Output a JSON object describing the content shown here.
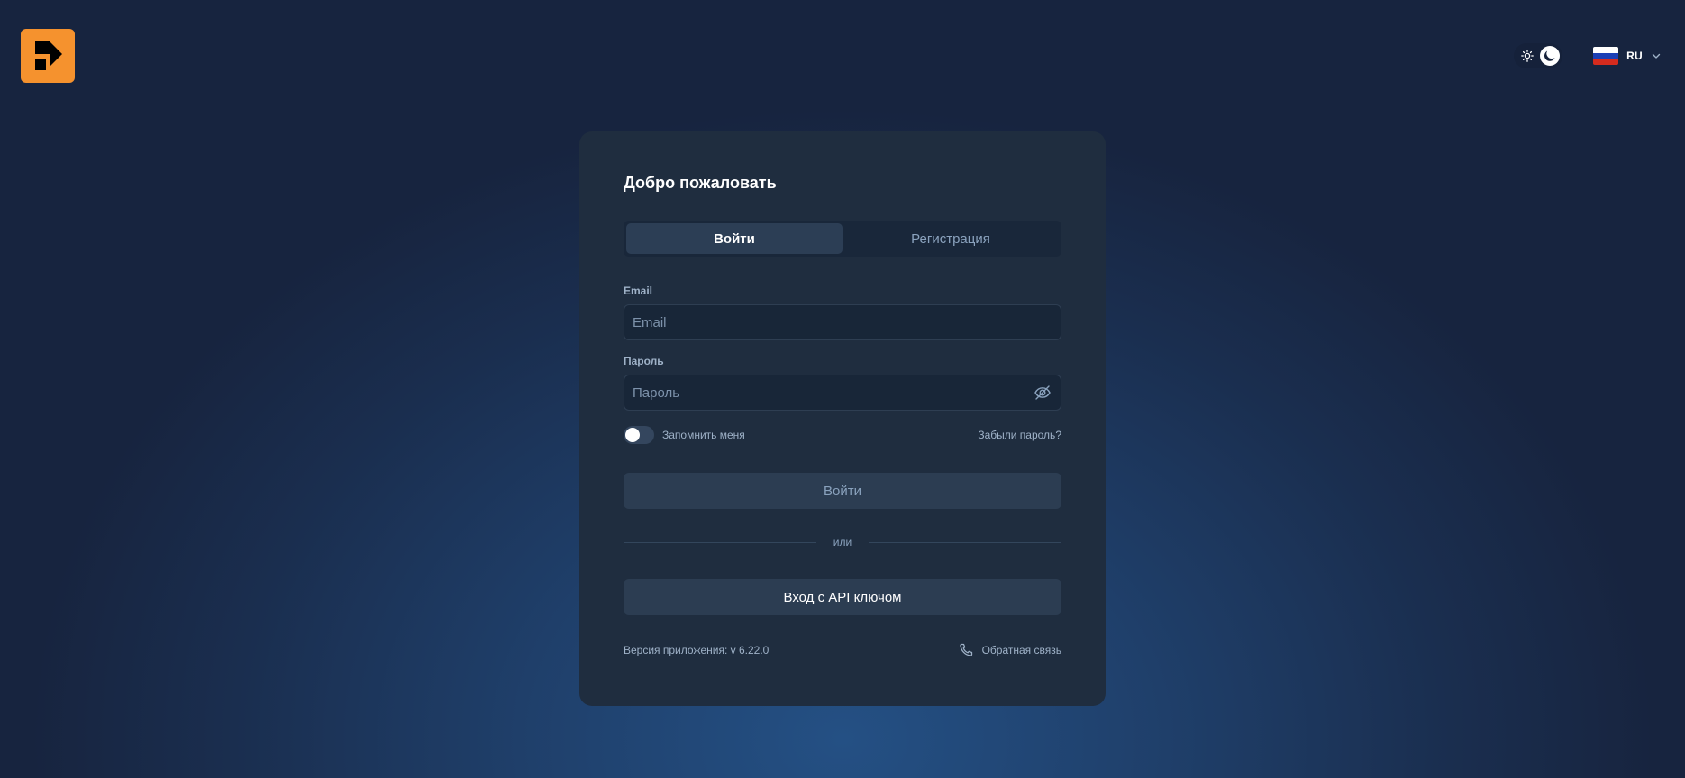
{
  "header": {
    "logo_icon": "brand-logo-icon",
    "theme": {
      "sun_icon": "sun-icon",
      "moon_icon": "moon-icon",
      "active": "dark"
    },
    "language": {
      "code": "RU",
      "flag_icon": "russian-flag-icon",
      "chevron_icon": "chevron-down-icon"
    }
  },
  "card": {
    "title": "Добро пожаловать",
    "tabs": [
      {
        "label": "Войти",
        "active": true
      },
      {
        "label": "Регистрация",
        "active": false
      }
    ],
    "email": {
      "label": "Email",
      "placeholder": "Email",
      "value": ""
    },
    "password": {
      "label": "Пароль",
      "placeholder": "Пароль",
      "value": "",
      "toggle_icon": "eye-off-icon"
    },
    "remember": {
      "label": "Запомнить меня",
      "checked": false
    },
    "forgot_label": "Забыли пароль?",
    "login_button": "Войти",
    "divider_text": "или",
    "api_button": "Вход с API ключом",
    "version_text": "Версия приложения: v 6.22.0",
    "feedback": {
      "label": "Обратная связь",
      "icon": "phone-icon"
    }
  },
  "colors": {
    "brand": "#f5922e",
    "card_bg": "#1f2d3f",
    "input_bg": "#182638",
    "button_bg": "#2c3d52",
    "muted_text": "#9fb2c8"
  }
}
